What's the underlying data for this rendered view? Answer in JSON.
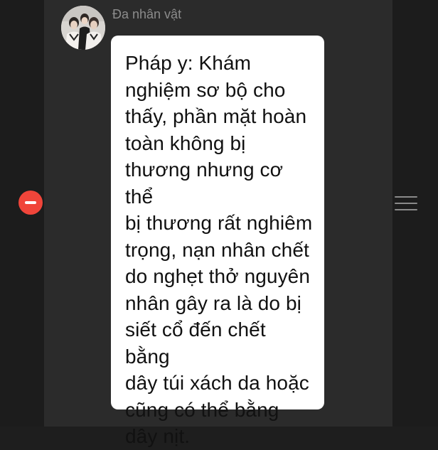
{
  "message": {
    "sender": "Đa nhân vật",
    "text": "Pháp y: Khám\nnghiệm sơ bộ cho\nthấy, phần mặt hoàn\ntoàn không bị\nthương nhưng cơ thể\nbị thương rất nghiêm\ntrọng, nạn nhân chết\ndo nghẹt thở nguyên\nnhân gây ra là do bị\nsiết cổ đến chết bằng\ndây túi xách da hoặc\ncũng có thể bằng\ndây nịt."
  },
  "icons": {
    "delete": "minus-circle-icon",
    "reorder": "drag-handle-icon"
  },
  "colors": {
    "delete_red": "#f0453a",
    "bubble": "#ffffff",
    "panel": "#2b2b2b"
  }
}
